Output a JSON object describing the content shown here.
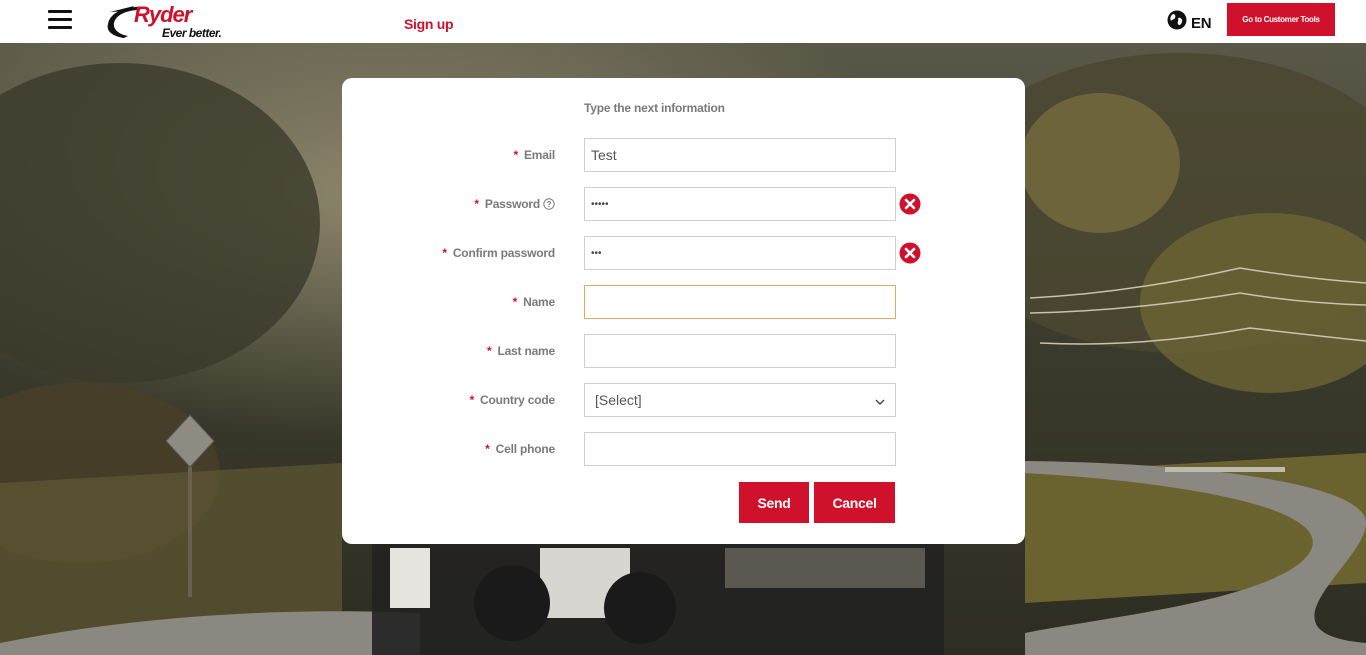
{
  "header": {
    "logo_text": "Ryder",
    "logo_tagline": "Ever better.",
    "signup_label": "Sign up",
    "language": "EN",
    "customer_tools_label": "Go to Customer Tools"
  },
  "form": {
    "title": "Type the next information",
    "required_marker": "*",
    "fields": [
      {
        "label": "Email",
        "value": "Test"
      },
      {
        "label": "Password",
        "value": "•••••"
      },
      {
        "label": "Confirm password",
        "value": "•••"
      },
      {
        "label": "Name",
        "value": ""
      },
      {
        "label": "Last name",
        "value": ""
      },
      {
        "label": "Country code",
        "value": "[Select]"
      },
      {
        "label": "Cell phone",
        "value": ""
      }
    ],
    "send_label": "Send",
    "cancel_label": "Cancel"
  },
  "colors": {
    "brand": "#d0112b",
    "label": "#7a7a7a",
    "focus_border": "#e8a766"
  },
  "icons": [
    "menu-icon",
    "globe-icon",
    "help-circle-icon",
    "error-icon",
    "chevron-down-icon"
  ]
}
